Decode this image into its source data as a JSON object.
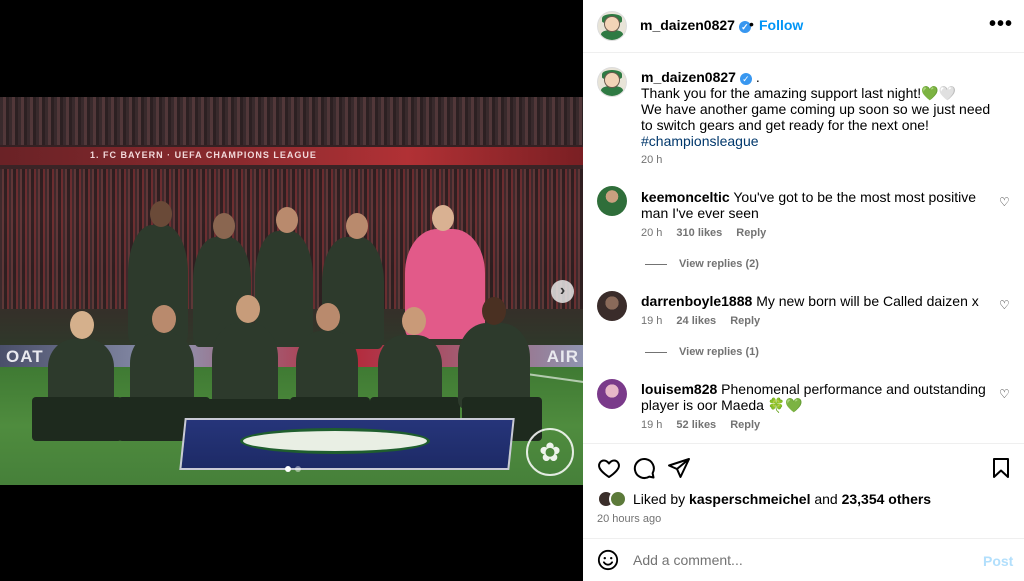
{
  "media": {
    "banner_left": "OAT",
    "banner_right": "AIR",
    "banner_top": "1. FC BAYERN · UEFA CHAMPIONS LEAGUE",
    "carousel": {
      "slide_count": 2,
      "active_slide": 1
    },
    "next_icon": "chevron-right-icon",
    "next_glyph": "›"
  },
  "header": {
    "username": "m_daizen0827",
    "separator": "•",
    "follow_label": "Follow",
    "more_glyph": "•••"
  },
  "caption": {
    "username": "m_daizen0827",
    "suffix": " .",
    "line1": "Thank you for the amazing support last night!",
    "heart1": "💚",
    "heart2": "🤍",
    "line2": "We have another game coming up soon so we just need to switch gears and get ready for the next one!",
    "hashtag": "#championsleague",
    "time": "20 h"
  },
  "comments": [
    {
      "username": "keemonceltic",
      "text": "You've got to be the most most positive man I've ever seen",
      "time": "20 h",
      "likes": "310 likes",
      "reply_label": "Reply",
      "view_replies": "View replies (2)"
    },
    {
      "username": "darrenboyle1888",
      "text": "My new born will be Called daizen x",
      "time": "19 h",
      "likes": "24 likes",
      "reply_label": "Reply",
      "view_replies": "View replies (1)"
    },
    {
      "username": "louisem828",
      "text": "Phenomenal performance and outstanding player is oor Maeda 🍀💚",
      "time": "19 h",
      "likes": "52 likes",
      "reply_label": "Reply"
    }
  ],
  "actions": {
    "icons": [
      "heart-icon",
      "comment-icon",
      "share-icon",
      "bookmark-icon"
    ]
  },
  "likes": {
    "prefix": "Liked by",
    "user": "kasperschmeichel",
    "middle": "and",
    "count": "23,354 others"
  },
  "posted_ago": "20 hours ago",
  "add_comment": {
    "placeholder": "Add a comment...",
    "post_label": "Post"
  },
  "colors": {
    "accent": "#0095f6",
    "hashtag": "#00376b",
    "muted": "#737373",
    "post_disabled": "#b2dffc",
    "verified": "#3897f0"
  }
}
